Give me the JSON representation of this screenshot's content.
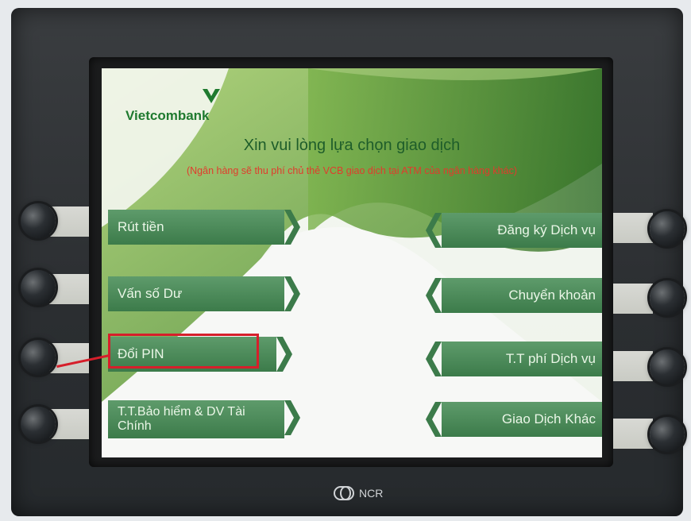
{
  "bank": {
    "name": "Vietcombank"
  },
  "screen": {
    "title": "Xin vui lòng lựa chọn giao dịch",
    "notice": "(Ngân hàng sẽ thu phí chủ thẻ VCB giao dịch tại ATM của ngân hàng khác)"
  },
  "menu": {
    "left": [
      {
        "label": "Rút tiền"
      },
      {
        "label": "Vấn số Dư"
      },
      {
        "label": "Đổi PIN"
      },
      {
        "label": "T.T.Bảo hiểm & DV Tài Chính"
      }
    ],
    "right": [
      {
        "label": "Đăng ký Dịch vụ"
      },
      {
        "label": "Chuyển khoản"
      },
      {
        "label": "T.T phí Dịch vụ"
      },
      {
        "label": "Giao Dịch Khác"
      }
    ]
  },
  "machine": {
    "brand": "NCR"
  },
  "highlight": {
    "selected": "Đổi PIN",
    "color": "#d61f2b"
  },
  "colors": {
    "button_green": "#3c7b4a",
    "notice_red": "#e13b2c",
    "title_green": "#1e5d2a"
  }
}
